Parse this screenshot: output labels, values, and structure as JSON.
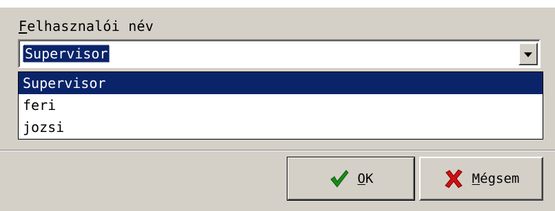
{
  "field": {
    "label": "Felhasznalói név",
    "label_mnemonic": "F",
    "label_rest": "elhasznalói név"
  },
  "combo": {
    "value": "Supervisor",
    "dropdown_icon": "chevron-down-icon"
  },
  "list": {
    "items": [
      "Supervisor",
      "feri",
      "jozsi"
    ],
    "selected_index": 0
  },
  "buttons": {
    "ok": {
      "mnemonic": "O",
      "rest": "K",
      "label": "OK",
      "icon": "checkmark-icon",
      "icon_color": "#1a8a1a"
    },
    "cancel": {
      "mnemonic": "M",
      "rest": "égsem",
      "label": "Mégsem",
      "icon": "x-icon",
      "icon_color": "#d01010"
    }
  },
  "colors": {
    "window_bg": "#d4d0c8",
    "selection_bg": "#0a246a",
    "selection_fg": "#ffffff"
  }
}
